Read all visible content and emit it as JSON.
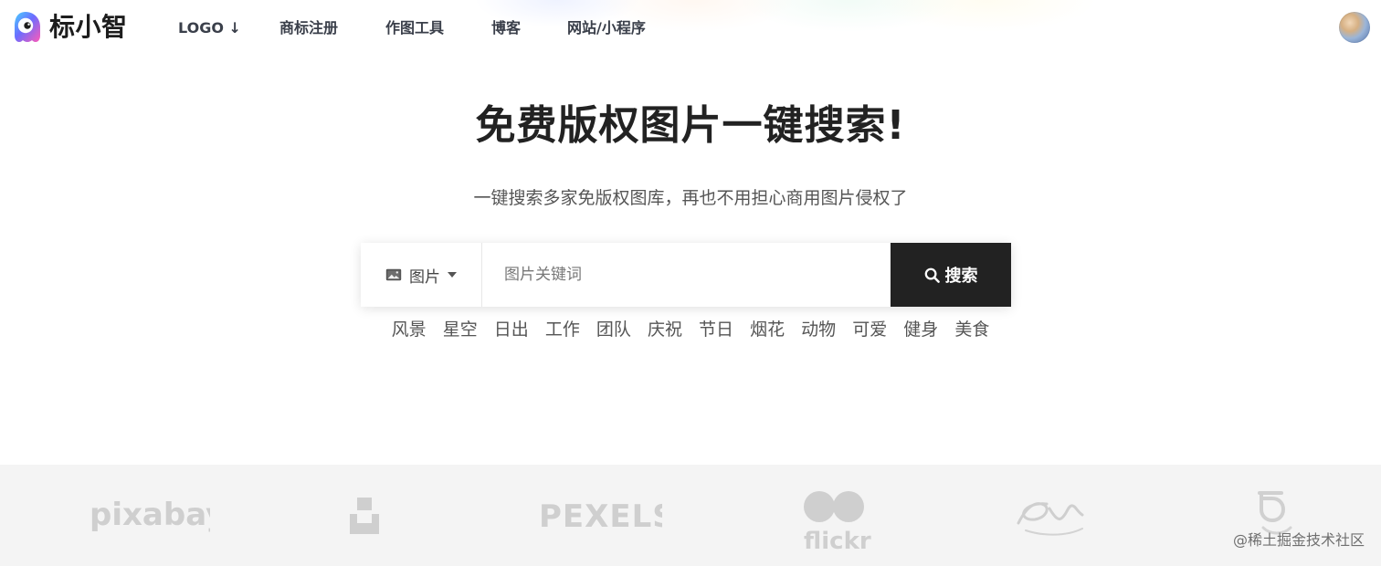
{
  "header": {
    "brand_name": "标小智",
    "nav": [
      {
        "label": "LOGO ↓"
      },
      {
        "label": "商标注册"
      },
      {
        "label": "作图工具"
      },
      {
        "label": "博客"
      },
      {
        "label": "网站/小程序"
      }
    ]
  },
  "hero": {
    "title": "免费版权图片一键搜索!",
    "subtitle": "一键搜索多家免版权图库，再也不用担心商用图片侵权了"
  },
  "search": {
    "type_label": "图片",
    "placeholder": "图片关键词",
    "button_label": "搜索"
  },
  "tags": [
    "风景",
    "星空",
    "日出",
    "工作",
    "团队",
    "庆祝",
    "节日",
    "烟花",
    "动物",
    "可爱",
    "健身",
    "美食"
  ],
  "partners": {
    "pixabay": "pixabay",
    "pexels": "PEXELS",
    "flickr": "flickr"
  },
  "watermark": "@稀土掘金技术社区",
  "colors": {
    "accent_dark": "#222222",
    "partners_bg": "#f4f4f4",
    "logo_gray": "#cfcfcf"
  },
  "icons": {
    "brand": "brand-mascot-icon",
    "image": "image-icon",
    "caret": "caret-down-icon",
    "search": "search-icon",
    "avatar": "avatar"
  }
}
